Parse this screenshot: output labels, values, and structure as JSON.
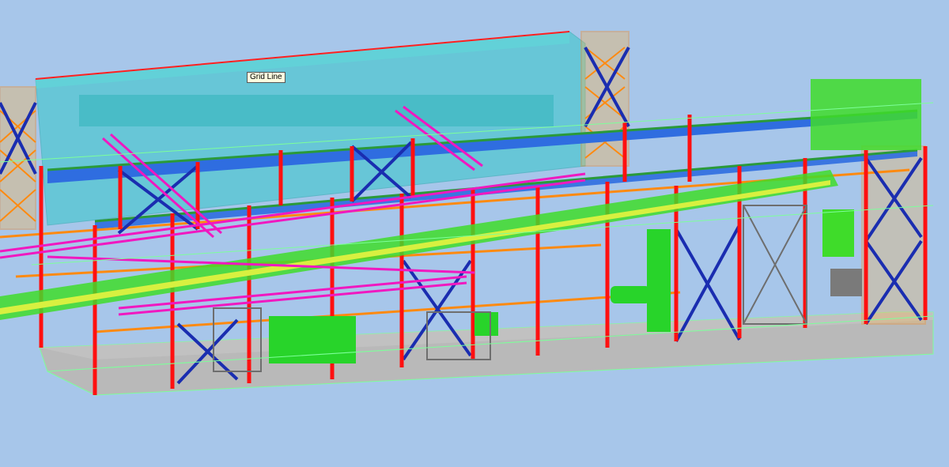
{
  "viewport": {
    "background": "#a7c6ea",
    "tooltip": "Grid Line"
  },
  "palette": {
    "column": "#ff1010",
    "bracing": "#1a2db0",
    "beam": "#2f6de0",
    "building": "#34c6c9",
    "piping": "#f018c0",
    "conveyor": "#3fdc2a",
    "equipment": "#28d42a",
    "steel_grey": "#6e6e6e",
    "gridline": "#7dff9a",
    "scaffold": "#ff8a10",
    "floor": "#b7b7b7"
  }
}
